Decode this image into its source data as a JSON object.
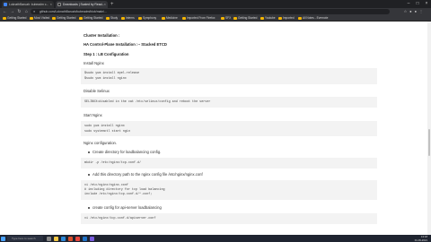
{
  "browser": {
    "tabs": [
      {
        "label": "LoknathBaruah: kubeadm c..."
      },
      {
        "label": "Downloads | Scaled by Read..."
      }
    ],
    "address": "github.com/LoknathBaruah/kubeadm/blob/main/...",
    "bookmarks": [
      "Getting Started",
      "Most Visited",
      "Getting Started",
      "Getting Started",
      "Study",
      "Interns",
      "Symphony",
      "Medicine",
      "Imported From Firefox",
      "SFX",
      "Getting Started",
      "Youtube",
      "Imported",
      "All Notes - Evernote"
    ]
  },
  "doc": {
    "h_cluster": "Cluster Installation :",
    "h_ha": "HA Control-Plane Installation :-- Stacked ETCD",
    "h_step": "Step 1 : LB Configuration",
    "install_nginx": "Install Nginx",
    "code1": [
      "$sudo yum install epel-release",
      "$sudo yum install nginx"
    ],
    "disable_selinux": "Disable Selinux",
    "code2": [
      "SELINUX=disabled in the cat /etc/selinux/config and reboot the server"
    ],
    "start_nginx": "Start Nginx",
    "code3": [
      "sudo yum install nginx",
      "sudo systemctl start ngin"
    ],
    "nginx_config": "Nginx configuration.",
    "b1": "Create directory for loadbalancing config.",
    "code4": [
      "mkdir -p /etc/nginx/tcp.conf.d/"
    ],
    "b2": "Add this directory path to the nginx config file /etc/nginx/nginx.conf",
    "code5": [
      "vi /etc/nginx/nginx.conf",
      "# including directory for tcp load balancing",
      "include /etc/nginx/tcp.conf.d/*.conf;"
    ],
    "b3": "create config for api-server loadbalancing",
    "code6": [
      "vi /etc/nginx/tcp.conf.d/apiserver.conf"
    ]
  },
  "taskbar": {
    "search": "Type here to search",
    "time": "13:18",
    "date": "01-09-2021"
  }
}
